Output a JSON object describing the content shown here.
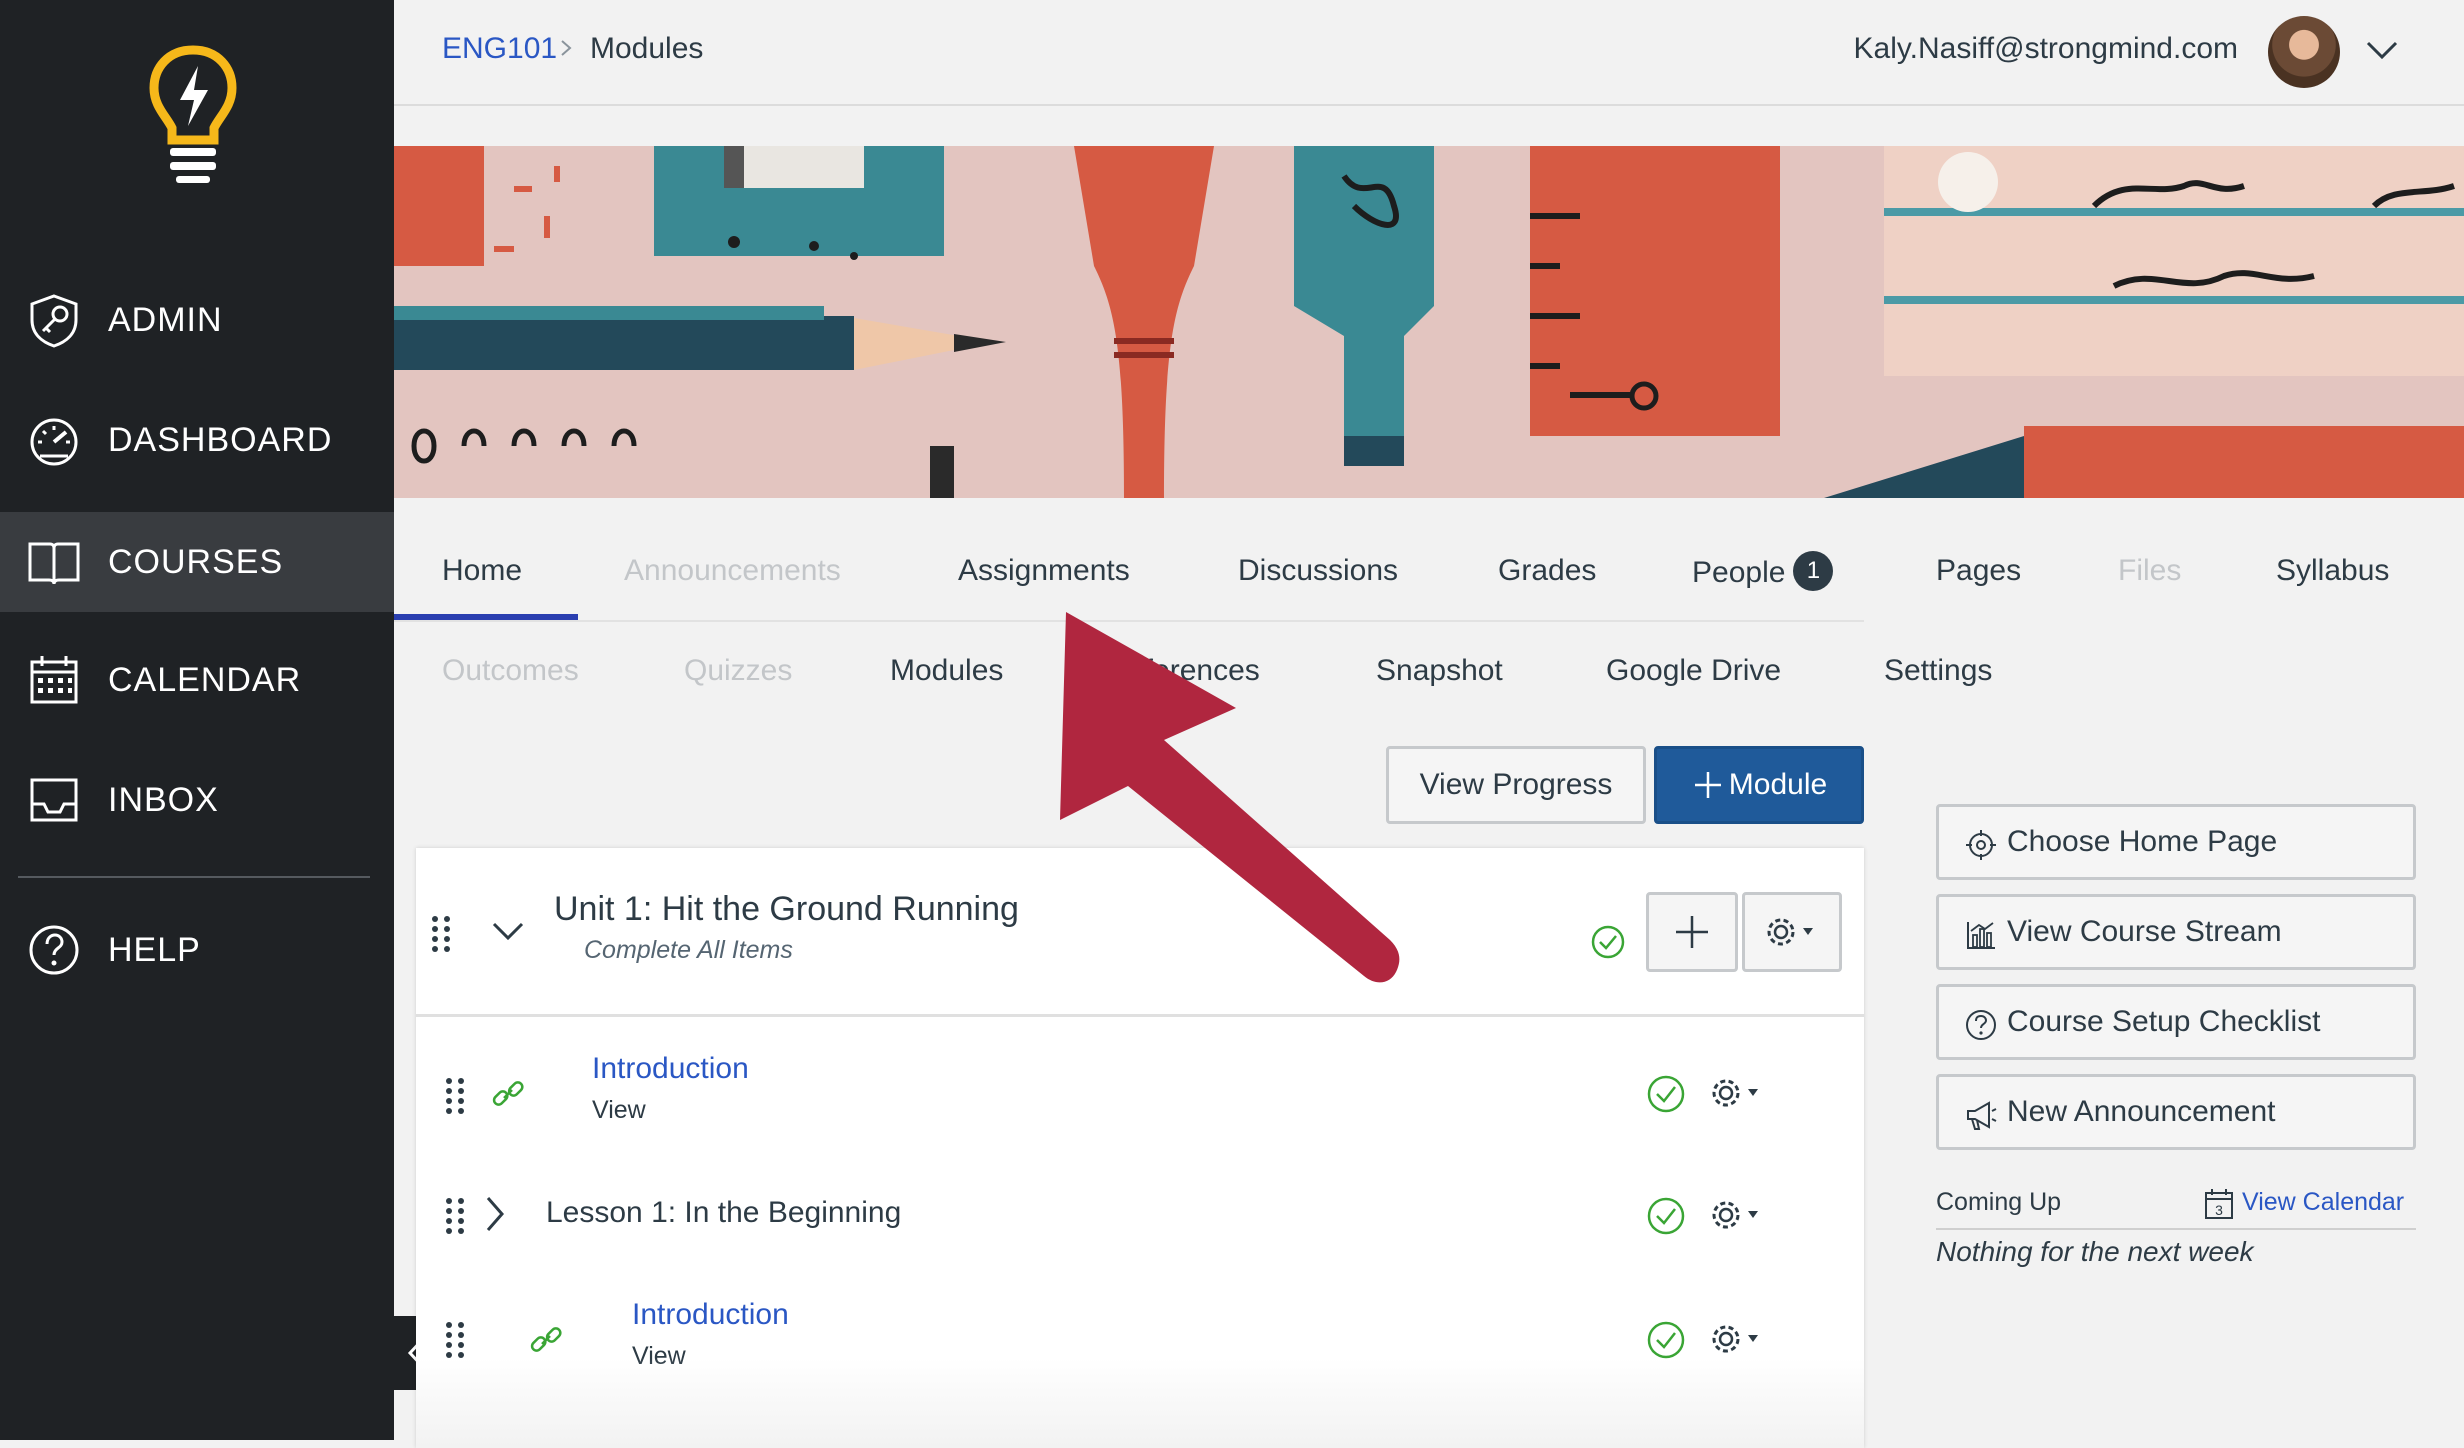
{
  "sidebar": {
    "items": [
      {
        "label": "ADMIN",
        "icon": "shield-key-icon"
      },
      {
        "label": "DASHBOARD",
        "icon": "speedometer-icon"
      },
      {
        "label": "COURSES",
        "icon": "open-book-icon",
        "active": true
      },
      {
        "label": "CALENDAR",
        "icon": "calendar-icon"
      },
      {
        "label": "INBOX",
        "icon": "inbox-tray-icon"
      },
      {
        "label": "HELP",
        "icon": "question-circle-icon"
      }
    ],
    "logo_icon": "lightbulb-bolt-icon",
    "brand_color": "#f6b81a"
  },
  "breadcrumb": {
    "course": "ENG101",
    "current": "Modules"
  },
  "user": {
    "email": "Kaly.Nasiff@strongmind.com"
  },
  "course_nav": {
    "row1": [
      {
        "label": "Home",
        "state": "active"
      },
      {
        "label": "Announcements",
        "state": "disabled"
      },
      {
        "label": "Assignments",
        "state": "enabled"
      },
      {
        "label": "Discussions",
        "state": "enabled"
      },
      {
        "label": "Grades",
        "state": "enabled"
      },
      {
        "label": "People",
        "state": "enabled",
        "badge": "1"
      },
      {
        "label": "Pages",
        "state": "enabled"
      },
      {
        "label": "Files",
        "state": "disabled"
      },
      {
        "label": "Syllabus",
        "state": "enabled"
      }
    ],
    "row2": [
      {
        "label": "Outcomes",
        "state": "disabled"
      },
      {
        "label": "Quizzes",
        "state": "disabled"
      },
      {
        "label": "Modules",
        "state": "enabled"
      },
      {
        "label": "nferences",
        "state": "enabled"
      },
      {
        "label": "Snapshot",
        "state": "enabled"
      },
      {
        "label": "Google Drive",
        "state": "enabled"
      },
      {
        "label": "Settings",
        "state": "enabled"
      }
    ]
  },
  "toolbar": {
    "view_progress": "View Progress",
    "add_module": "Module"
  },
  "module": {
    "title": "Unit 1: Hit the Ground Running",
    "requirement": "Complete All Items",
    "items": [
      {
        "type": "link",
        "title": "Introduction",
        "sub": "View"
      },
      {
        "type": "subheader",
        "title": "Lesson 1: In the Beginning"
      },
      {
        "type": "link",
        "title": "Introduction",
        "sub": "View"
      }
    ]
  },
  "right_sidebar": {
    "buttons": [
      {
        "label": "Choose Home Page",
        "icon": "target-icon"
      },
      {
        "label": "View Course Stream",
        "icon": "bar-chart-icon"
      },
      {
        "label": "Course Setup Checklist",
        "icon": "question-circle-icon"
      },
      {
        "label": "New Announcement",
        "icon": "megaphone-icon"
      }
    ],
    "coming_up": "Coming Up",
    "view_calendar": "View Calendar",
    "calendar_day": "3",
    "nothing": "Nothing for the next week"
  },
  "colors": {
    "link": "#2a57c4",
    "primary_button": "#1f5a9a",
    "success": "#3aa535",
    "annotation_arrow": "#b0263f"
  }
}
